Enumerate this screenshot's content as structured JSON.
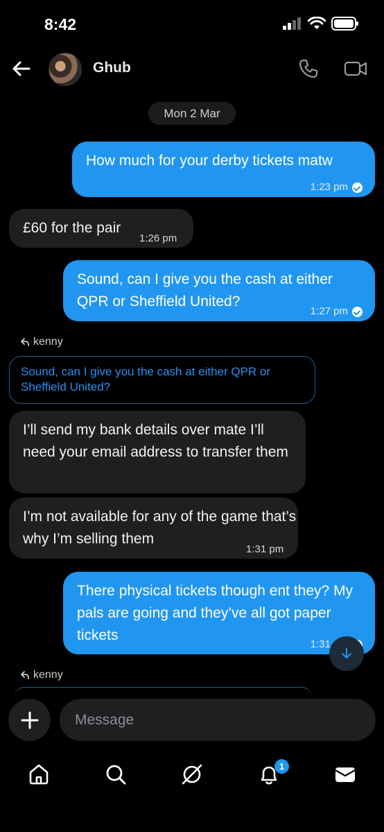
{
  "status_bar": {
    "time": "8:42"
  },
  "header": {
    "contact_name": "Ghub"
  },
  "date_chip": "Mon 2 Mar",
  "messages": [
    {
      "dir": "out",
      "text": "How much for your derby tickets matw",
      "time": "1:23 pm"
    },
    {
      "dir": "in",
      "text": "£60 for the pair",
      "time": "1:26 pm"
    },
    {
      "dir": "out",
      "text": "Sound, can I give you the cash at either QPR or Sheffield United?",
      "time": "1:27 pm"
    },
    {
      "dir": "in",
      "reply_to": "kenny",
      "quote": "Sound, can I give you the cash at either QPR or Sheffield United?",
      "text": "I’ll send my bank details over mate I’ll need your email address to transfer them"
    },
    {
      "dir": "in",
      "text": "I’m not available for any of the game that’s why I’m selling them",
      "time": "1:31 pm"
    },
    {
      "dir": "out",
      "text": "There physical tickets though ent they? My pals are going and they’ve all got paper tickets",
      "time": "1:31 pm"
    },
    {
      "dir": "in",
      "reply_to": "kenny"
    }
  ],
  "composer": {
    "placeholder": "Message"
  },
  "tabbar": {
    "notifications_badge": "1"
  },
  "colors": {
    "accent": "#2196f0",
    "incoming_bubble": "#1f1f22",
    "background": "#000000"
  }
}
